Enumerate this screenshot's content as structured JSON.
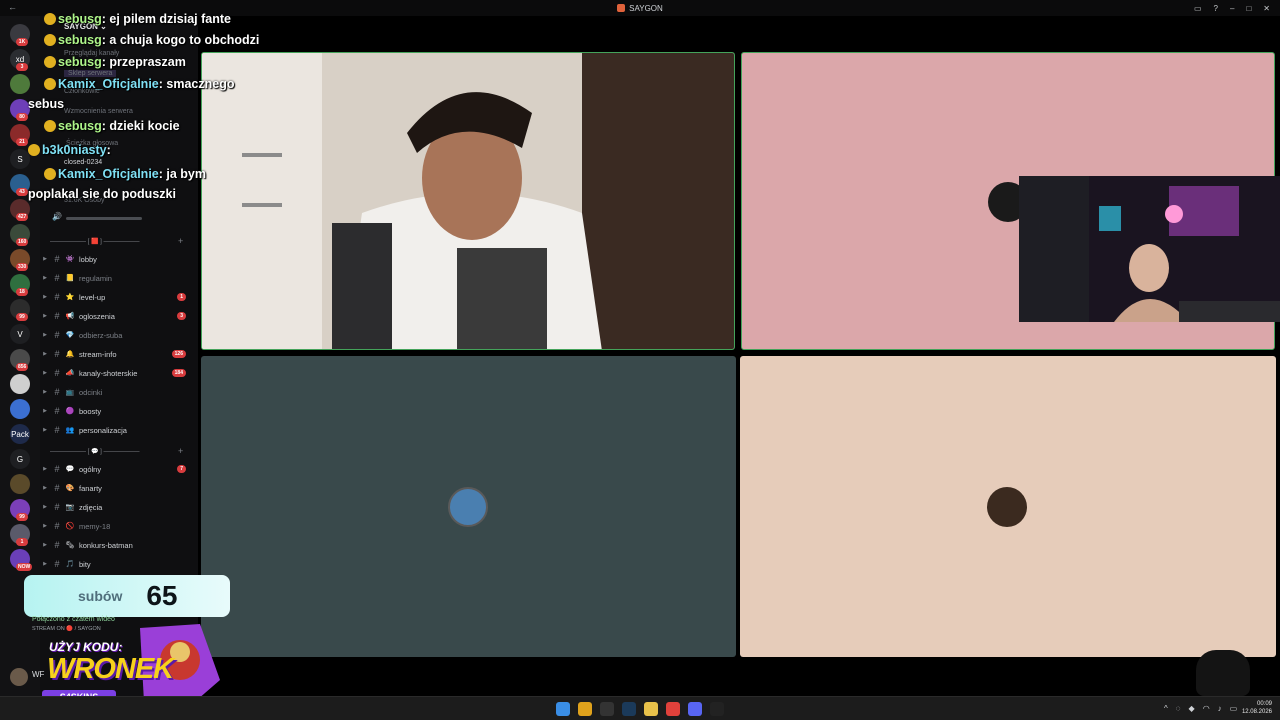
{
  "titlebar": {
    "app_name": "SAYGON",
    "back": "←",
    "window_controls": [
      "▭",
      "?",
      "–",
      "□",
      "✕"
    ]
  },
  "server_rail": {
    "servers": [
      {
        "icon": "server-avatar",
        "text": "",
        "color": "#3a3a40",
        "badge": "1K"
      },
      {
        "icon": "server-avatar",
        "text": "xd",
        "color": "#2b2d31",
        "badge": "3"
      },
      {
        "icon": "server-avatar",
        "text": "",
        "color": "#4e7a3b",
        "badge": ""
      },
      {
        "icon": "server-avatar",
        "text": "",
        "color": "#6e3fb8",
        "badge": "80"
      },
      {
        "icon": "server-avatar",
        "text": "",
        "color": "#8b2a2a",
        "badge": "21"
      },
      {
        "icon": "server-avatar",
        "text": "S",
        "color": "#1e1f22",
        "badge": ""
      },
      {
        "icon": "server-avatar",
        "text": "",
        "color": "#2a5f8f",
        "badge": "43"
      },
      {
        "icon": "server-avatar",
        "text": "",
        "color": "#5a2b2b",
        "badge": "427"
      },
      {
        "icon": "server-avatar",
        "text": "",
        "color": "#3a4a3a",
        "badge": "160"
      },
      {
        "icon": "server-avatar",
        "text": "",
        "color": "#7a4a2a",
        "badge": "330"
      },
      {
        "icon": "server-avatar",
        "text": "",
        "color": "#2f6f3f",
        "badge": "18"
      },
      {
        "icon": "server-avatar",
        "text": "",
        "color": "#2c2c2c",
        "badge": "99"
      },
      {
        "icon": "server-avatar",
        "text": "V",
        "color": "#1e1f22",
        "badge": ""
      },
      {
        "icon": "server-avatar",
        "text": "",
        "color": "#4a4a4a",
        "badge": "856"
      },
      {
        "icon": "server-avatar",
        "text": "",
        "color": "#cfcfcf",
        "badge": ""
      },
      {
        "icon": "server-avatar",
        "text": "",
        "color": "#3b6fd1",
        "badge": ""
      },
      {
        "icon": "server-avatar",
        "text": "Pack",
        "color": "#1e2a4a",
        "badge": ""
      },
      {
        "icon": "server-avatar",
        "text": "G",
        "color": "#1e1f22",
        "badge": ""
      },
      {
        "icon": "server-avatar",
        "text": "",
        "color": "#5a4a2a",
        "badge": ""
      },
      {
        "icon": "server-avatar",
        "text": "",
        "color": "#7b3fb8",
        "badge": "99"
      },
      {
        "icon": "server-avatar",
        "text": "",
        "color": "#5a5a6a",
        "badge": "1"
      },
      {
        "icon": "server-avatar",
        "text": "",
        "color": "#6a3fb8",
        "badge": "NOW"
      }
    ]
  },
  "sidebar": {
    "server_name": "SAYGON",
    "menu": [
      "Przeglądaj kanały",
      "Sklep serwera",
      "Członkowie",
      "Wzmocnienia serwera"
    ],
    "voice_channel": "closed-0234",
    "sub_item": "Ścieżka głosowa",
    "members": "31.6K Osoby",
    "categories": [
      "[ 🟥 ]",
      "[ 💬 ]"
    ],
    "channels_a": [
      {
        "name": "lobby",
        "emoji": "👾",
        "muted": false,
        "badge": ""
      },
      {
        "name": "regulamin",
        "emoji": "📒",
        "muted": true,
        "badge": ""
      },
      {
        "name": "level-up",
        "emoji": "⭐",
        "muted": false,
        "badge": "1"
      },
      {
        "name": "ogloszenia",
        "emoji": "📢",
        "muted": false,
        "badge": "3"
      },
      {
        "name": "odbierz-suba",
        "emoji": "💎",
        "muted": true,
        "badge": ""
      },
      {
        "name": "stream-info",
        "emoji": "🔔",
        "muted": false,
        "badge": "126"
      },
      {
        "name": "kanaly-shoterskie",
        "emoji": "📣",
        "muted": false,
        "badge": "184"
      },
      {
        "name": "odcinki",
        "emoji": "📺",
        "muted": true,
        "badge": ""
      },
      {
        "name": "boosty",
        "emoji": "🟣",
        "muted": false,
        "badge": ""
      },
      {
        "name": "personalizacja",
        "emoji": "👥",
        "muted": false,
        "badge": ""
      }
    ],
    "channels_b": [
      {
        "name": "ogólny",
        "emoji": "💬",
        "muted": false,
        "badge": "7"
      },
      {
        "name": "fanarty",
        "emoji": "🎨",
        "muted": false,
        "badge": ""
      },
      {
        "name": "zdjęcia",
        "emoji": "📷",
        "muted": false,
        "badge": ""
      },
      {
        "name": "memy-18",
        "emoji": "🚫",
        "muted": true,
        "badge": ""
      },
      {
        "name": "konkurs-batman",
        "emoji": "🗞",
        "muted": false,
        "badge": ""
      },
      {
        "name": "bity",
        "emoji": "🎵",
        "muted": false,
        "badge": ""
      }
    ],
    "connection_status": "Połączono z czatem wideo",
    "connection_sub": "STREAM ON 🔴 / SAYGON",
    "user_short": "WF"
  },
  "chat": [
    {
      "user": "sebusg",
      "text": "ej pilem dzisiaj fante",
      "color": "#aef58a"
    },
    {
      "user": "sebusg",
      "text": "a chuja kogo to obchodzi",
      "color": "#aef58a"
    },
    {
      "user": "sebusg",
      "text": "przepraszam",
      "color": "#aef58a"
    },
    {
      "user": "Kamix_Oficjalnie",
      "text": "smacznego",
      "color": "#7fe0f4"
    },
    {
      "user": "",
      "text": "sebus",
      "color": "#ffffff"
    },
    {
      "user": "sebusg",
      "text": "dzieki kocie",
      "color": "#aef58a"
    },
    {
      "user": "b3k0niasty",
      "text": "",
      "color": "#7fe0f4"
    },
    {
      "user": "Kamix_Oficjalnie",
      "text": "ja bym",
      "color": "#7fe0f4"
    },
    {
      "user": "",
      "text": "poplakal sie do poduszki",
      "color": "#ffffff"
    }
  ],
  "subs": {
    "label": "subów",
    "count": "65"
  },
  "promo": {
    "line1": "UŻYJ KODU:",
    "code": "WRONEK",
    "brand": "S4SKINS"
  },
  "taskbar": {
    "time": "00:09",
    "date": "12.08.2026",
    "apps": [
      {
        "icon": "windows-start-icon",
        "color": "#3a8ee6"
      },
      {
        "icon": "chrome-icon",
        "color": "#e0a21c"
      },
      {
        "icon": "obs-icon",
        "color": "#333333"
      },
      {
        "icon": "steam-icon",
        "color": "#1b3a5a"
      },
      {
        "icon": "folder-icon",
        "color": "#e8c14a"
      },
      {
        "icon": "valorant-icon",
        "color": "#e0413b"
      },
      {
        "icon": "discord-icon",
        "color": "#5865f2"
      },
      {
        "icon": "capcut-icon",
        "color": "#222222"
      }
    ]
  }
}
